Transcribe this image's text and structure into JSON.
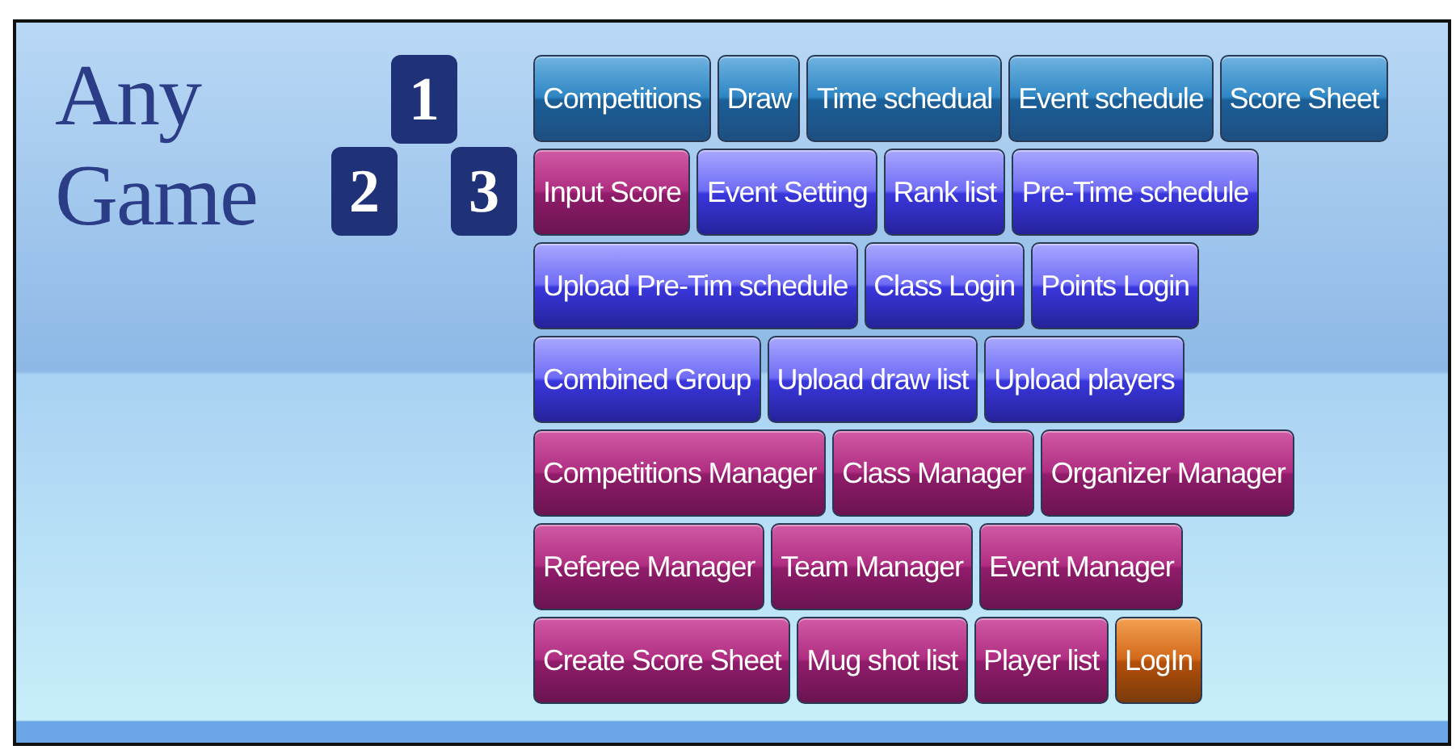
{
  "logo": {
    "words": [
      "Any",
      "Game"
    ],
    "tiles": [
      "1",
      "2",
      "3"
    ]
  },
  "menu_rows": [
    [
      {
        "label": "Competitions",
        "kind": "teal"
      },
      {
        "label": "Draw",
        "kind": "teal"
      },
      {
        "label": "Time schedual",
        "kind": "teal"
      },
      {
        "label": "Event schedule",
        "kind": "teal"
      },
      {
        "label": "Score Sheet",
        "kind": "teal"
      }
    ],
    [
      {
        "label": "Input Score",
        "kind": "magenta"
      },
      {
        "label": "Event Setting",
        "kind": "blue"
      },
      {
        "label": "Rank list",
        "kind": "blue"
      },
      {
        "label": "Pre-Time schedule",
        "kind": "blue"
      }
    ],
    [
      {
        "label": "Upload Pre-Tim schedule",
        "kind": "blue"
      },
      {
        "label": "Class Login",
        "kind": "blue"
      },
      {
        "label": "Points Login",
        "kind": "blue"
      }
    ],
    [
      {
        "label": "Combined Group",
        "kind": "blue"
      },
      {
        "label": "Upload draw list",
        "kind": "blue"
      },
      {
        "label": "Upload players",
        "kind": "blue"
      }
    ],
    [
      {
        "label": "Competitions Manager",
        "kind": "magenta"
      },
      {
        "label": "Class Manager",
        "kind": "magenta"
      },
      {
        "label": "Organizer Manager",
        "kind": "magenta"
      }
    ],
    [
      {
        "label": "Referee Manager",
        "kind": "magenta"
      },
      {
        "label": "Team Manager",
        "kind": "magenta"
      },
      {
        "label": "Event Manager",
        "kind": "magenta"
      }
    ],
    [
      {
        "label": "Create Score Sheet",
        "kind": "magenta"
      },
      {
        "label": "Mug shot list",
        "kind": "magenta"
      },
      {
        "label": "Player list",
        "kind": "magenta"
      },
      {
        "label": "LogIn",
        "kind": "orange"
      }
    ]
  ]
}
